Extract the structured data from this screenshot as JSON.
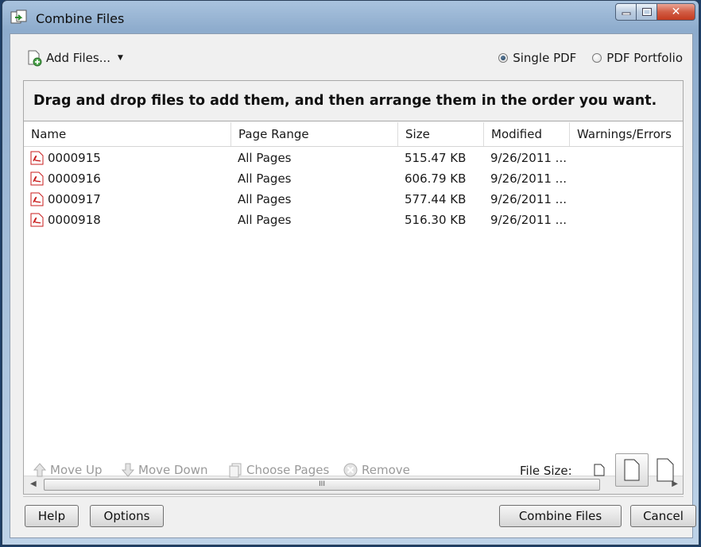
{
  "window": {
    "title": "Combine Files"
  },
  "toolbar": {
    "add_files_label": "Add Files...",
    "mode_options": [
      {
        "label": "Single PDF",
        "selected": true
      },
      {
        "label": "PDF Portfolio",
        "selected": false
      }
    ]
  },
  "instruction": "Drag and drop files to add them, and then arrange them in the order you want.",
  "table": {
    "columns": [
      "Name",
      "Page Range",
      "Size",
      "Modified",
      "Warnings/Errors"
    ],
    "rows": [
      {
        "name": "0000915",
        "page_range": "All Pages",
        "size": "515.47 KB",
        "modified": "9/26/2011 ...",
        "warnings": ""
      },
      {
        "name": "0000916",
        "page_range": "All Pages",
        "size": "606.79 KB",
        "modified": "9/26/2011 ...",
        "warnings": ""
      },
      {
        "name": "0000917",
        "page_range": "All Pages",
        "size": "577.44 KB",
        "modified": "9/26/2011 ...",
        "warnings": ""
      },
      {
        "name": "0000918",
        "page_range": "All Pages",
        "size": "516.30 KB",
        "modified": "9/26/2011 ...",
        "warnings": ""
      }
    ],
    "scroll_thumb_grip": "III"
  },
  "actions": {
    "move_up": "Move Up",
    "move_down": "Move Down",
    "choose_pages": "Choose Pages",
    "remove": "Remove",
    "file_size_label": "File Size:"
  },
  "footer": {
    "help": "Help",
    "options": "Options",
    "combine": "Combine Files",
    "cancel": "Cancel"
  }
}
